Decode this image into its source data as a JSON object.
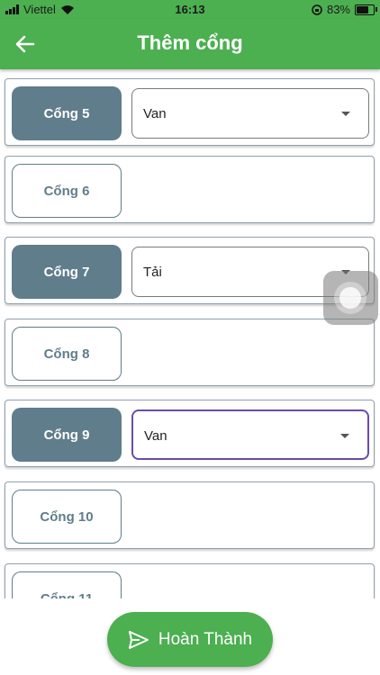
{
  "status": {
    "carrier": "Viettel",
    "time": "16:13",
    "battery": "83%",
    "battery_level": 0.83
  },
  "header": {
    "title": "Thêm cổng",
    "back_icon": "arrow-left-icon"
  },
  "gates": [
    {
      "label": "Cổng 5",
      "selected": true,
      "type": "Van"
    },
    {
      "label": "Cổng 6",
      "selected": false
    },
    {
      "label": "Cổng 7",
      "selected": true,
      "type": "Tải"
    },
    {
      "label": "Cổng 8",
      "selected": false
    },
    {
      "label": "Cổng 9",
      "selected": true,
      "type": "Van",
      "focused": true
    },
    {
      "label": "Cổng 10",
      "selected": false
    },
    {
      "label": "Cổng 11",
      "selected": false
    }
  ],
  "footer": {
    "finish_label": "Hoàn Thành",
    "finish_icon": "send-icon"
  },
  "colors": {
    "primary": "#4caf50",
    "gate_active": "#607d8b",
    "focus": "#6a4ca8"
  }
}
